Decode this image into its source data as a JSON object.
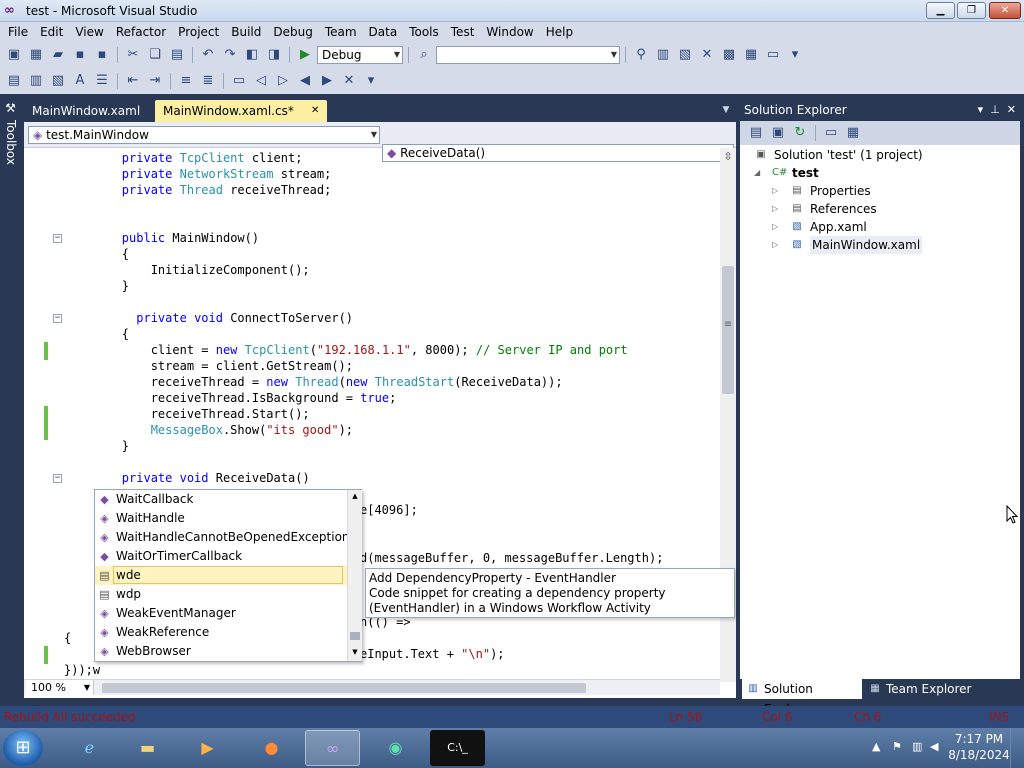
{
  "window": {
    "title": "test - Microsoft Visual Studio"
  },
  "menu": [
    "File",
    "Edit",
    "View",
    "Refactor",
    "Project",
    "Build",
    "Debug",
    "Team",
    "Data",
    "Tools",
    "Test",
    "Window",
    "Help"
  ],
  "toolbar": {
    "config": "Debug",
    "platform": ""
  },
  "toolbox_label": "Toolbox",
  "tabs": [
    {
      "label": "MainWindow.xaml"
    },
    {
      "label": "MainWindow.xaml.cs*"
    }
  ],
  "nav": {
    "type": "test.MainWindow",
    "member": "ReceiveData()"
  },
  "code": {
    "l1a": "private",
    "l1b": "TcpClient",
    "l1c": "client;",
    "l2a": "private",
    "l2b": "NetworkStream",
    "l2c": "stream;",
    "l3a": "private",
    "l3b": "Thread",
    "l3c": "receiveThread;",
    "l4a": "public",
    "l4b": "MainWindow()",
    "l5": "{",
    "l6": "InitializeComponent();",
    "l7": "}",
    "l8a": "private",
    "l8b": "void",
    "l8c": "ConnectToServer()",
    "l9": "{",
    "l10a": "client = ",
    "l10b": "new",
    "l10c": "TcpClient",
    "l10d": "(",
    "l10e": "\"192.168.1.1\"",
    "l10f": ", 8000); ",
    "l10g": "// Server IP and port",
    "l11": "stream = client.GetStream();",
    "l12a": "receiveThread = ",
    "l12b": "new",
    "l12c": "Thread",
    "l12d": "(",
    "l12e": "new",
    "l12f": "ThreadStart",
    "l12g": "(ReceiveData));",
    "l13a": "receiveThread.IsBackground = ",
    "l13b": "true",
    "l13c": ";",
    "l14": "receiveThread.Start();",
    "l15a": "MessageBox",
    "l15b": ".Show(",
    "l15c": "\"its good\"",
    "l15d": ");",
    "l16": "}",
    "l17a": "private",
    "l17b": "void",
    "l17c": "ReceiveData()",
    "l18": "e[4096];",
    "l19": "d(messageBuffer, 0, messageBuffer.Length);",
    "l20": "n(() =>",
    "l21": "{",
    "l22a": "eInput.Text + ",
    "l22b": "\"\\n\"",
    "l22c": ");",
    "l23": "}));w"
  },
  "completion": [
    {
      "label": "WaitCallback",
      "icon": "delegate-icon",
      "glyph": "◆"
    },
    {
      "label": "WaitHandle",
      "icon": "class-icon",
      "glyph": "◈"
    },
    {
      "label": "WaitHandleCannotBeOpenedException",
      "icon": "class-icon",
      "glyph": "◈"
    },
    {
      "label": "WaitOrTimerCallback",
      "icon": "delegate-icon",
      "glyph": "◆"
    },
    {
      "label": "wde",
      "icon": "snippet-icon",
      "glyph": "▤",
      "selected": true
    },
    {
      "label": "wdp",
      "icon": "snippet-icon",
      "glyph": "▤"
    },
    {
      "label": "WeakEventManager",
      "icon": "class-icon",
      "glyph": "◈"
    },
    {
      "label": "WeakReference",
      "icon": "class-icon",
      "glyph": "◈"
    },
    {
      "label": "WebBrowser",
      "icon": "class-icon",
      "glyph": "◈"
    }
  ],
  "tooltip": {
    "title": "Add DependencyProperty - EventHandler",
    "body": "Code snippet for creating a dependency property (EventHandler) in a Windows Workflow Activity"
  },
  "editor": {
    "zoom": "100 %"
  },
  "solution_explorer": {
    "title": "Solution Explorer",
    "nodes": [
      {
        "label": "Solution 'test' (1 project)"
      },
      {
        "label": "test"
      },
      {
        "label": "Properties"
      },
      {
        "label": "References"
      },
      {
        "label": "App.xaml"
      },
      {
        "label": "MainWindow.xaml"
      }
    ],
    "tabs": [
      {
        "label": "Solution Explorer"
      },
      {
        "label": "Team Explorer"
      }
    ]
  },
  "status": {
    "message": "Rebuild All succeeded",
    "ln": "Ln 56",
    "col": "Col 6",
    "ch": "Ch 6",
    "mode": "INS"
  },
  "clock": {
    "time": "7:17 PM",
    "date": "8/18/2024"
  },
  "colors": {
    "accent": "#293955",
    "tab_active": "#fcefa1",
    "keyword": "#0000ff",
    "type": "#2b91af",
    "string": "#a31515",
    "comment": "#008000"
  }
}
